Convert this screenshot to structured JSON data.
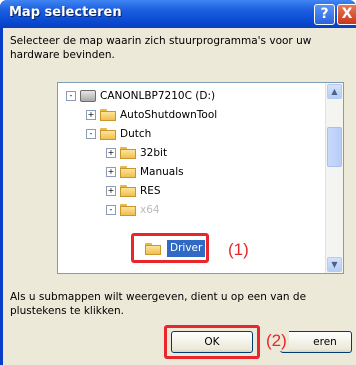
{
  "window": {
    "title": "Map selecteren",
    "help_glyph": "?",
    "close_glyph": "X"
  },
  "description": "Selecteer de map waarin zich stuurprogramma's voor uw hardware bevinden.",
  "tree": {
    "drive_label": "CANONLBP7210C (D:)",
    "items": [
      {
        "label": "AutoShutdownTool",
        "expander": "+"
      },
      {
        "label": "Dutch",
        "expander": "-"
      },
      {
        "label": "32bit",
        "expander": "+"
      },
      {
        "label": "Manuals",
        "expander": "+"
      },
      {
        "label": "RES",
        "expander": "+"
      },
      {
        "label": "x64",
        "expander": "-"
      }
    ],
    "selected_label": "Driver"
  },
  "callouts": {
    "one": "(1)",
    "two": "(2)"
  },
  "hint": "Als u submappen wilt weergeven, dient u op een van de plustekens te klikken.",
  "buttons": {
    "ok": "OK",
    "cancel_visible": "eren"
  }
}
